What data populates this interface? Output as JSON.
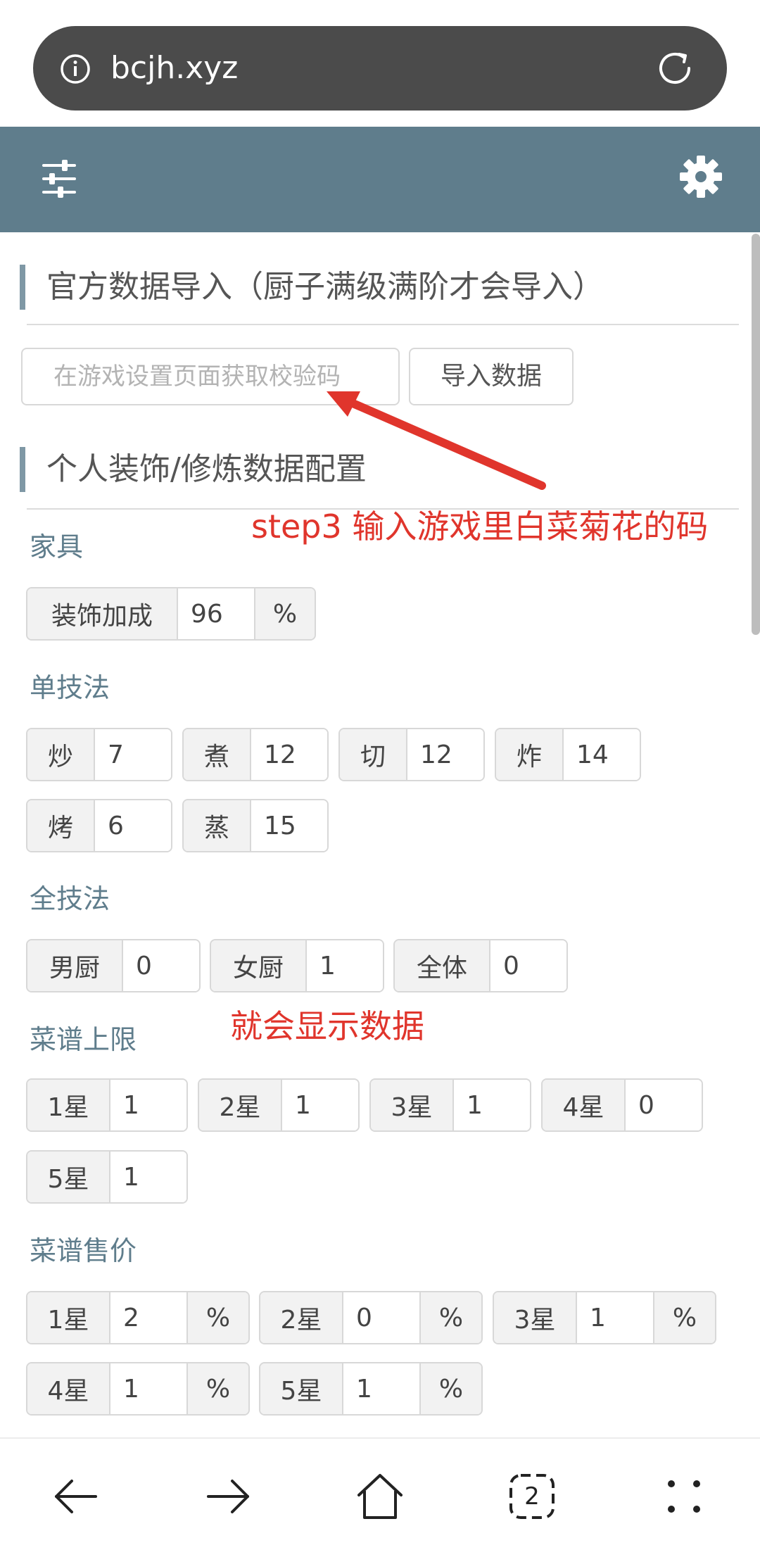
{
  "browser": {
    "url": "bcjh.xyz",
    "tab_count": "2"
  },
  "import_section": {
    "title": "官方数据导入（厨子满级满阶才会导入）",
    "input_placeholder": "在游戏设置页面获取校验码",
    "button_label": "导入数据"
  },
  "config_section": {
    "title": "个人装饰/修炼数据配置"
  },
  "furniture": {
    "label": "家具",
    "decor_label": "装饰加成",
    "decor_value": "96",
    "decor_unit": "%"
  },
  "single_skill": {
    "label": "单技法",
    "items": [
      {
        "name": "炒",
        "value": "7"
      },
      {
        "name": "煮",
        "value": "12"
      },
      {
        "name": "切",
        "value": "12"
      },
      {
        "name": "炸",
        "value": "14"
      },
      {
        "name": "烤",
        "value": "6"
      },
      {
        "name": "蒸",
        "value": "15"
      }
    ]
  },
  "all_skill": {
    "label": "全技法",
    "items": [
      {
        "name": "男厨",
        "value": "0"
      },
      {
        "name": "女厨",
        "value": "1"
      },
      {
        "name": "全体",
        "value": "0"
      }
    ]
  },
  "recipe_limit": {
    "label": "菜谱上限",
    "items": [
      {
        "name": "1星",
        "value": "1"
      },
      {
        "name": "2星",
        "value": "1"
      },
      {
        "name": "3星",
        "value": "1"
      },
      {
        "name": "4星",
        "value": "0"
      },
      {
        "name": "5星",
        "value": "1"
      }
    ]
  },
  "recipe_price": {
    "label": "菜谱售价",
    "unit": "%",
    "items": [
      {
        "name": "1星",
        "value": "2"
      },
      {
        "name": "2星",
        "value": "0"
      },
      {
        "name": "3星",
        "value": "1"
      },
      {
        "name": "4星",
        "value": "1"
      },
      {
        "name": "5星",
        "value": "1"
      }
    ]
  },
  "annotations": {
    "step3": "step3 输入游戏里白菜菊花的码",
    "show_data": "就会显示数据",
    "color": "#e0352c"
  },
  "colors": {
    "header_bg": "#5f7d8c",
    "accent": "#7f98a5",
    "address_bar": "#4b4b4b"
  }
}
